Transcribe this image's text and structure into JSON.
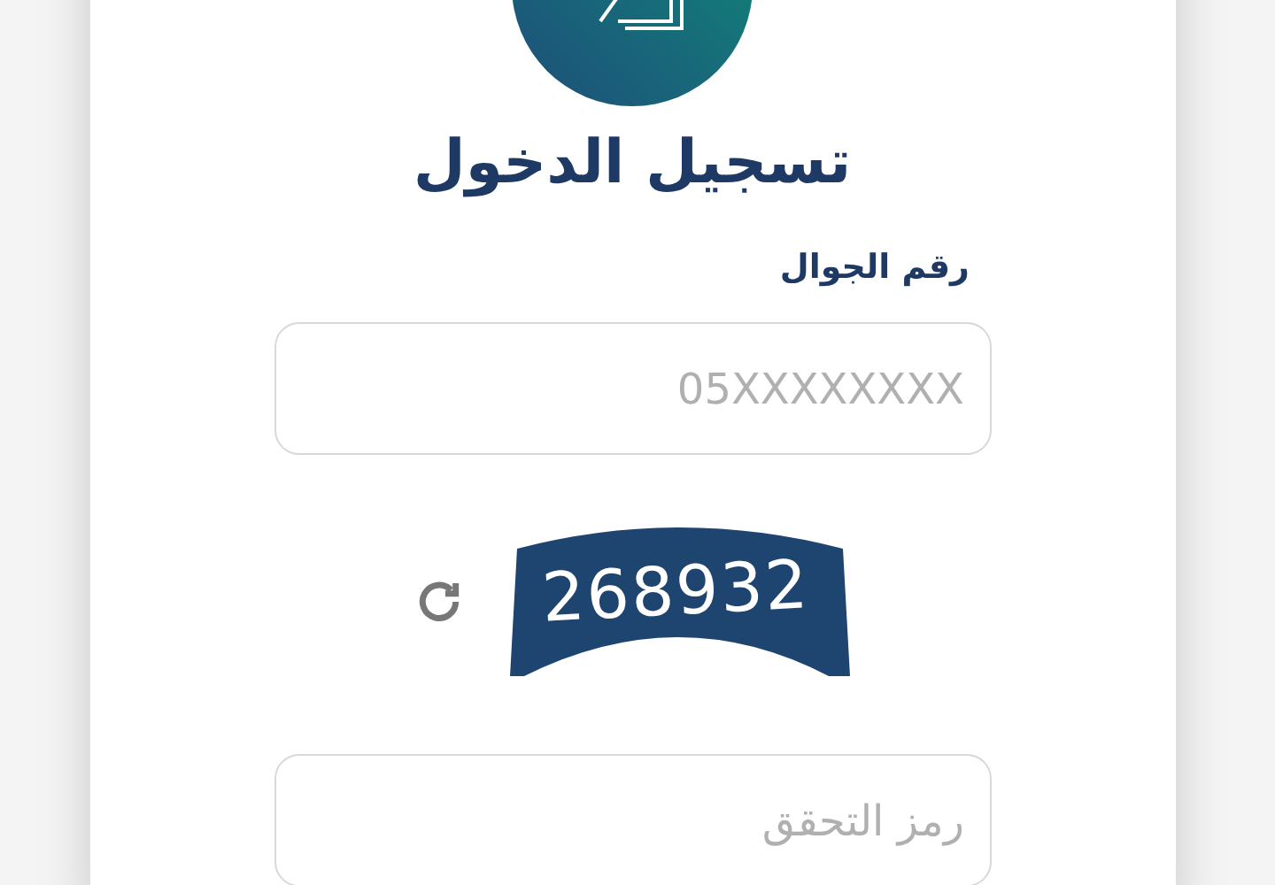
{
  "title": "تسجيل الدخول",
  "phone": {
    "label": "رقم الجوال",
    "placeholder": "05XXXXXXXX"
  },
  "captcha": {
    "code": "268932"
  },
  "code_field": {
    "placeholder": "رمز التحقق"
  }
}
